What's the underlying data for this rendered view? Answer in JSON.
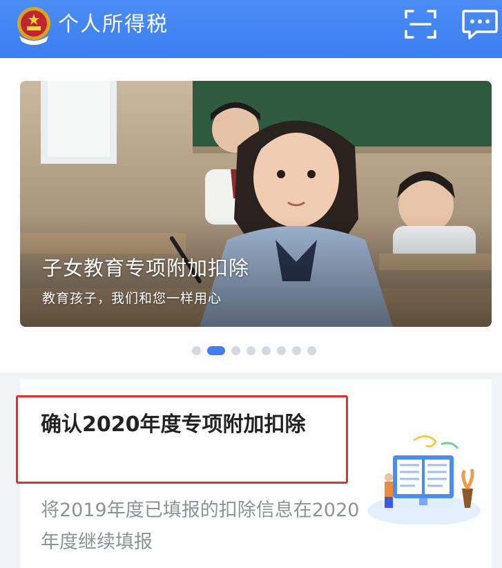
{
  "header": {
    "title": "个人所得税",
    "icons": {
      "emblem": "tax-emblem-icon",
      "scan": "scan-icon",
      "message": "message-icon"
    },
    "colors": {
      "background": "#3d7ef0",
      "text": "#ffffff"
    }
  },
  "banner": {
    "title": "子女教育专项附加扣除",
    "subtitle": "教育孩子，我们和您一样用心",
    "dots_count": 8,
    "active_index": 1
  },
  "task": {
    "title": "确认2020年度专项附加扣除",
    "description": "将2019年度已填报的扣除信息在2020年度继续填报",
    "highlight_color": "#e0312b"
  }
}
